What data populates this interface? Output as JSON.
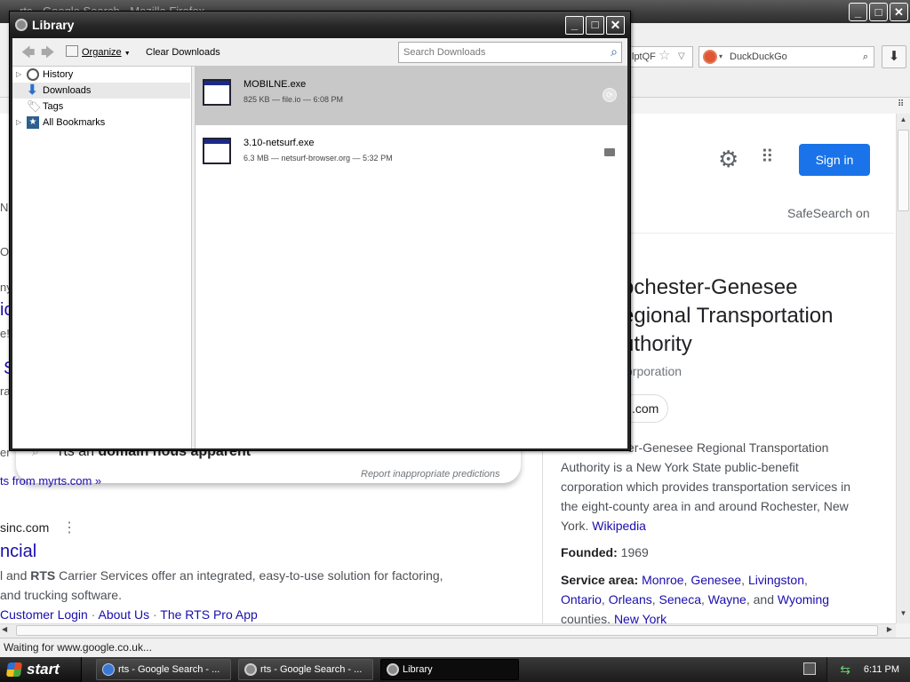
{
  "browser": {
    "title": "rts - Google Search - Mozilla Firefox",
    "url_fragment": "lptQF",
    "search_engine": "DuckDuckGo",
    "status_text": "Waiting for www.google.co.uk...",
    "google": {
      "sign_in": "Sign in",
      "safesearch": "SafeSearch on",
      "kp_title_lines": [
        "ochester-Genesee",
        "egional Transportation",
        "uthority"
      ],
      "kp_subtitle": "orporation",
      "kp_site_chip": ".com",
      "kp_desc_lines": [
        "er-Genesee Regional Transportation",
        "Authority is a New York State public-benefit",
        "corporation which provides transportation services in",
        "the eight-county area in and around Rochester, New"
      ],
      "kp_desc_end": "York.",
      "kp_wikipedia": "Wikipedia",
      "founded_label": "Founded:",
      "founded_value": "1969",
      "service_label": "Service area:",
      "service_line1": [
        "Monroe",
        "Genesee",
        "Livingston"
      ],
      "service_line2": [
        "Ontario",
        "Orleans",
        "Seneca",
        "Wayne",
        "Wyoming"
      ],
      "service_and": "and",
      "service_line3_text": "counties,",
      "service_line3_link": "New York",
      "autocomplete_text": "rts an ",
      "autocomplete_bold": "domain nous apparent",
      "report_predictions": "Report inappropriate predictions",
      "results_from": "ts from myrts.com »",
      "result_domain": "sinc.com",
      "result_title": "ncial",
      "result_snip1_pre": "l and ",
      "result_snip1_bold": "RTS",
      "result_snip1_post": " Carrier Services offer an integrated, easy-to-use solution for factoring,",
      "result_snip2": " and trucking software.",
      "result_links": [
        "Customer Login",
        "About Us",
        "The RTS Pro App"
      ],
      "left_frag": [
        "e",
        "Ne",
        "OC",
        "ny",
        "ic",
        "e!",
        "S",
        "ra",
        "er"
      ]
    }
  },
  "library": {
    "title": "Library",
    "toolbar": {
      "organize": "Organize",
      "clear": "Clear Downloads",
      "search_placeholder": "Search Downloads"
    },
    "tree": [
      {
        "label": "History",
        "has_twisty": true
      },
      {
        "label": "Downloads",
        "has_twisty": false
      },
      {
        "label": "Tags",
        "has_twisty": false
      },
      {
        "label": "All Bookmarks",
        "has_twisty": true
      }
    ],
    "downloads": [
      {
        "name": "MOBILNE.exe",
        "meta": "825 KB — file.io — 6:08 PM"
      },
      {
        "name": "3.10-netsurf.exe",
        "meta": "6.3 MB — netsurf-browser.org — 5:32 PM"
      }
    ]
  },
  "taskbar": {
    "start": "start",
    "tasks": [
      "rts - Google Search - ...",
      "rts - Google Search - ...",
      "Library"
    ],
    "clock": "6:11 PM"
  },
  "colors": {
    "google_blue": "#1a73e8",
    "link": "#1a0dab",
    "selected_row": "#c8c8c8"
  }
}
